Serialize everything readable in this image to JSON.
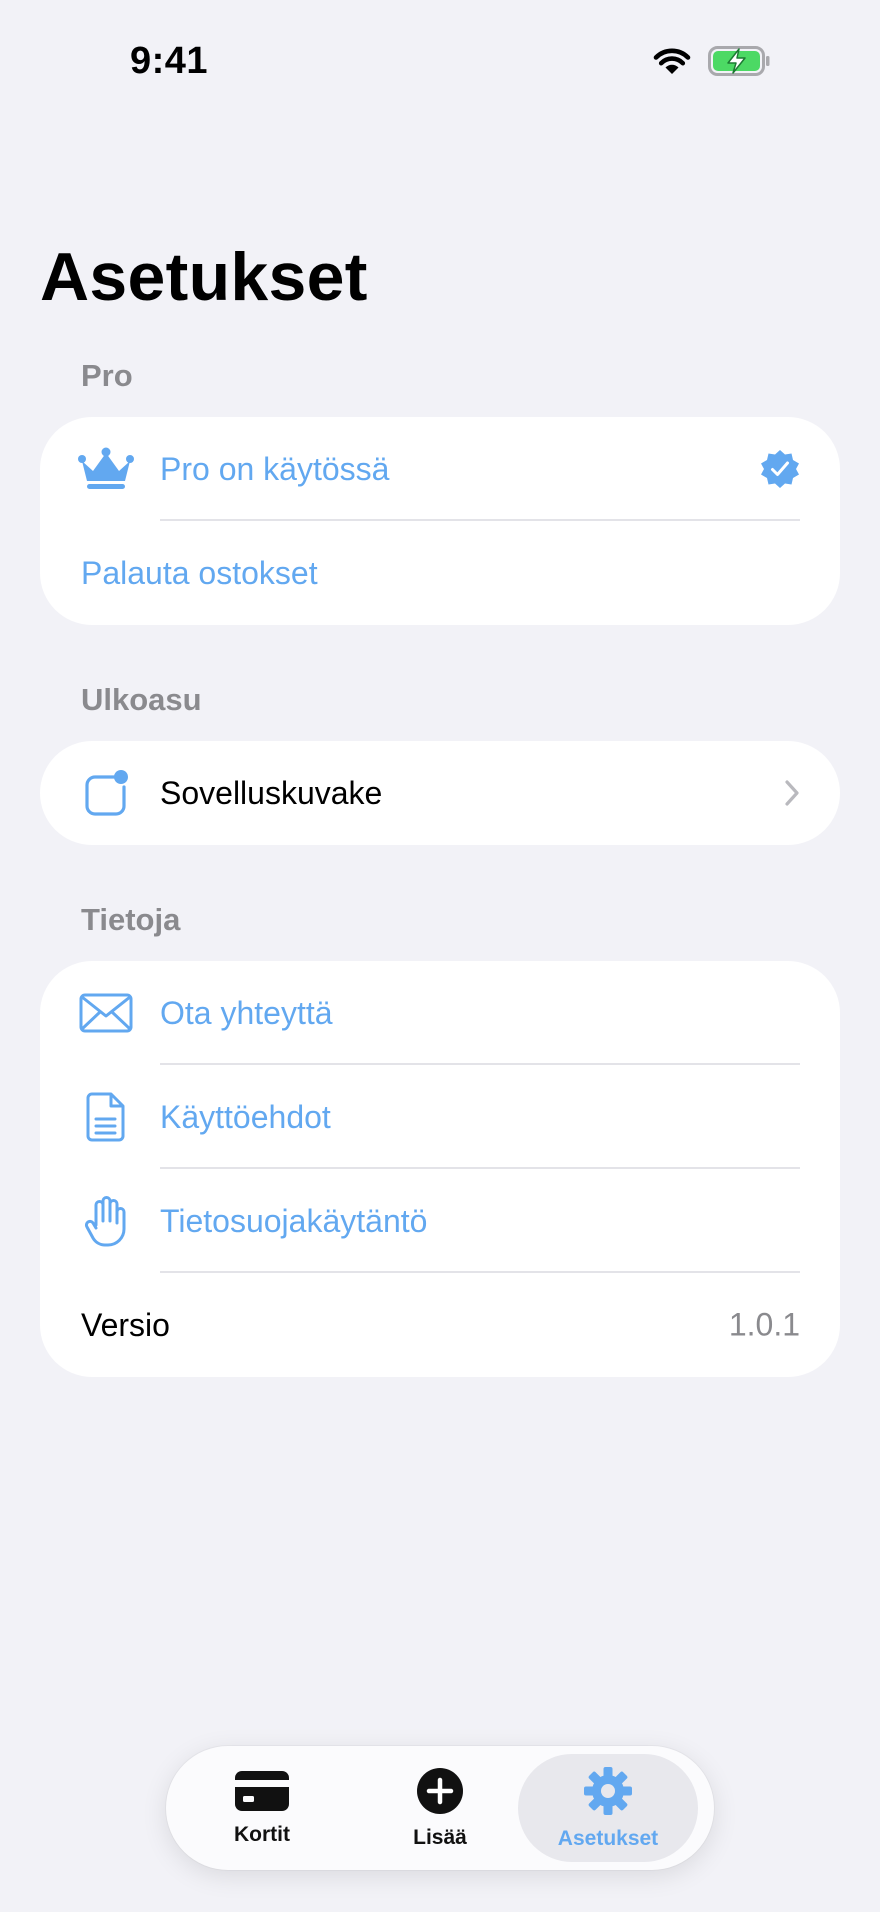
{
  "status_bar": {
    "time": "9:41",
    "icons": [
      "wifi-icon",
      "battery-charging-icon"
    ]
  },
  "page": {
    "title": "Asetukset"
  },
  "colors": {
    "accent": "#62a8f0",
    "background": "#f2f2f7",
    "secondary_text": "#8a8a8e",
    "battery": "#4cd964"
  },
  "sections": {
    "pro": {
      "header": "Pro",
      "rows": [
        {
          "label": "Pro on käytössä",
          "icon": "crown-icon",
          "trailing_icon": "verified-badge-icon"
        },
        {
          "label": "Palauta ostokset"
        }
      ]
    },
    "appearance": {
      "header": "Ulkoasu",
      "rows": [
        {
          "label": "Sovelluskuvake",
          "icon": "app-icon-badge-icon",
          "trailing_icon": "chevron-right-icon"
        }
      ]
    },
    "info": {
      "header": "Tietoja",
      "rows": [
        {
          "label": "Ota yhteyttä",
          "icon": "envelope-icon"
        },
        {
          "label": "Käyttöehdot",
          "icon": "document-icon"
        },
        {
          "label": "Tietosuojakäytäntö",
          "icon": "hand-raised-icon"
        },
        {
          "label": "Versio",
          "value": "1.0.1"
        }
      ]
    }
  },
  "tabbar": {
    "tabs": [
      {
        "label": "Kortit",
        "icon": "credit-card-icon",
        "active": false
      },
      {
        "label": "Lisää",
        "icon": "plus-circle-icon",
        "active": false
      },
      {
        "label": "Asetukset",
        "icon": "gear-icon",
        "active": true
      }
    ]
  }
}
